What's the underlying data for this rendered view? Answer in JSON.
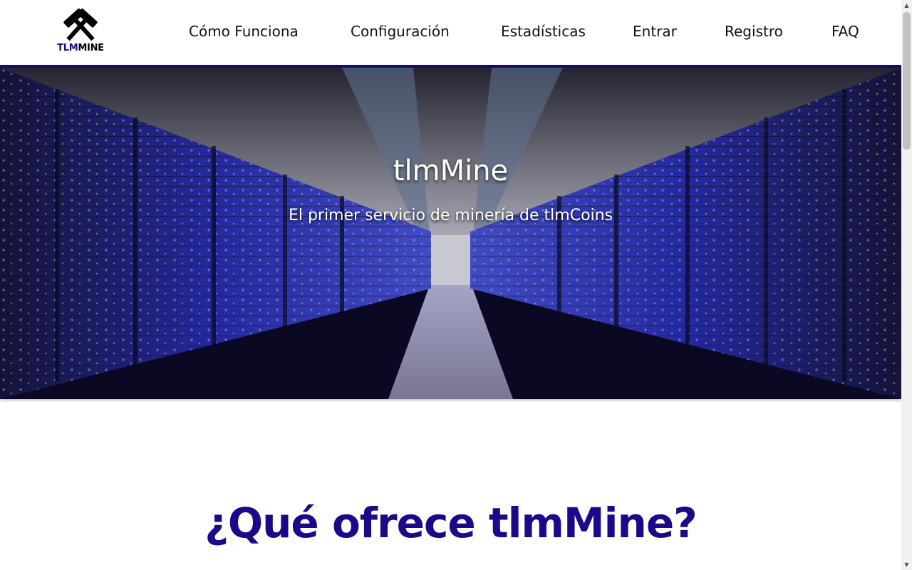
{
  "logo": {
    "text_tlm": "TLM",
    "text_mine": "MINE"
  },
  "nav": {
    "items": [
      {
        "label": "Cómo Funciona"
      },
      {
        "label": "Configuración"
      },
      {
        "label": "Estadísticas"
      },
      {
        "label": "Entrar"
      },
      {
        "label": "Registro"
      },
      {
        "label": "FAQ"
      }
    ]
  },
  "hero": {
    "title": "tlmMine",
    "subtitle": "El primer servicio de minería de tlmCoins"
  },
  "section": {
    "heading": "¿Qué ofrece tlmMine?"
  },
  "colors": {
    "brand": "#1a0a8a",
    "header_bar": "#150d6b"
  },
  "icons": {
    "logo": "crossed-hammers-icon"
  }
}
